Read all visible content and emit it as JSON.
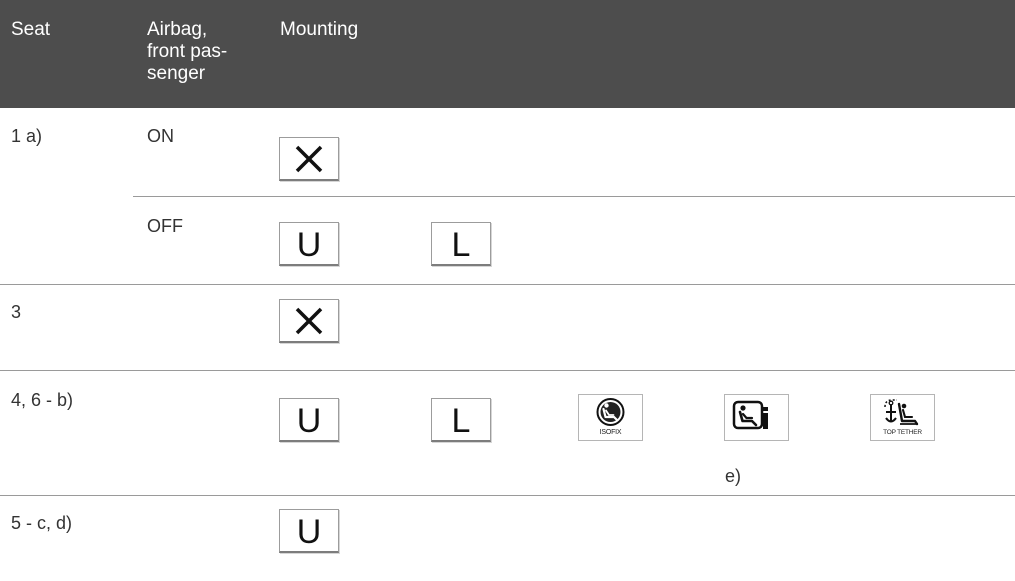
{
  "header": {
    "seat": "Seat",
    "airbag_lines": [
      "Airbag,",
      "front pas-",
      "senger"
    ],
    "mounting": "Mounting"
  },
  "rows": {
    "row1": {
      "seat": "1 a)",
      "airbag": "ON"
    },
    "row1b": {
      "airbag": "OFF"
    },
    "row2": {
      "seat": "3"
    },
    "row3": {
      "seat": "4, 6 - b)",
      "note": "e)"
    },
    "row4": {
      "seat": "5 - c, d)"
    }
  },
  "icons": {
    "universal": "U",
    "semi_universal": "L",
    "isofix_label": "ISOFIX",
    "top_tether_label": "TOP TETHER"
  }
}
